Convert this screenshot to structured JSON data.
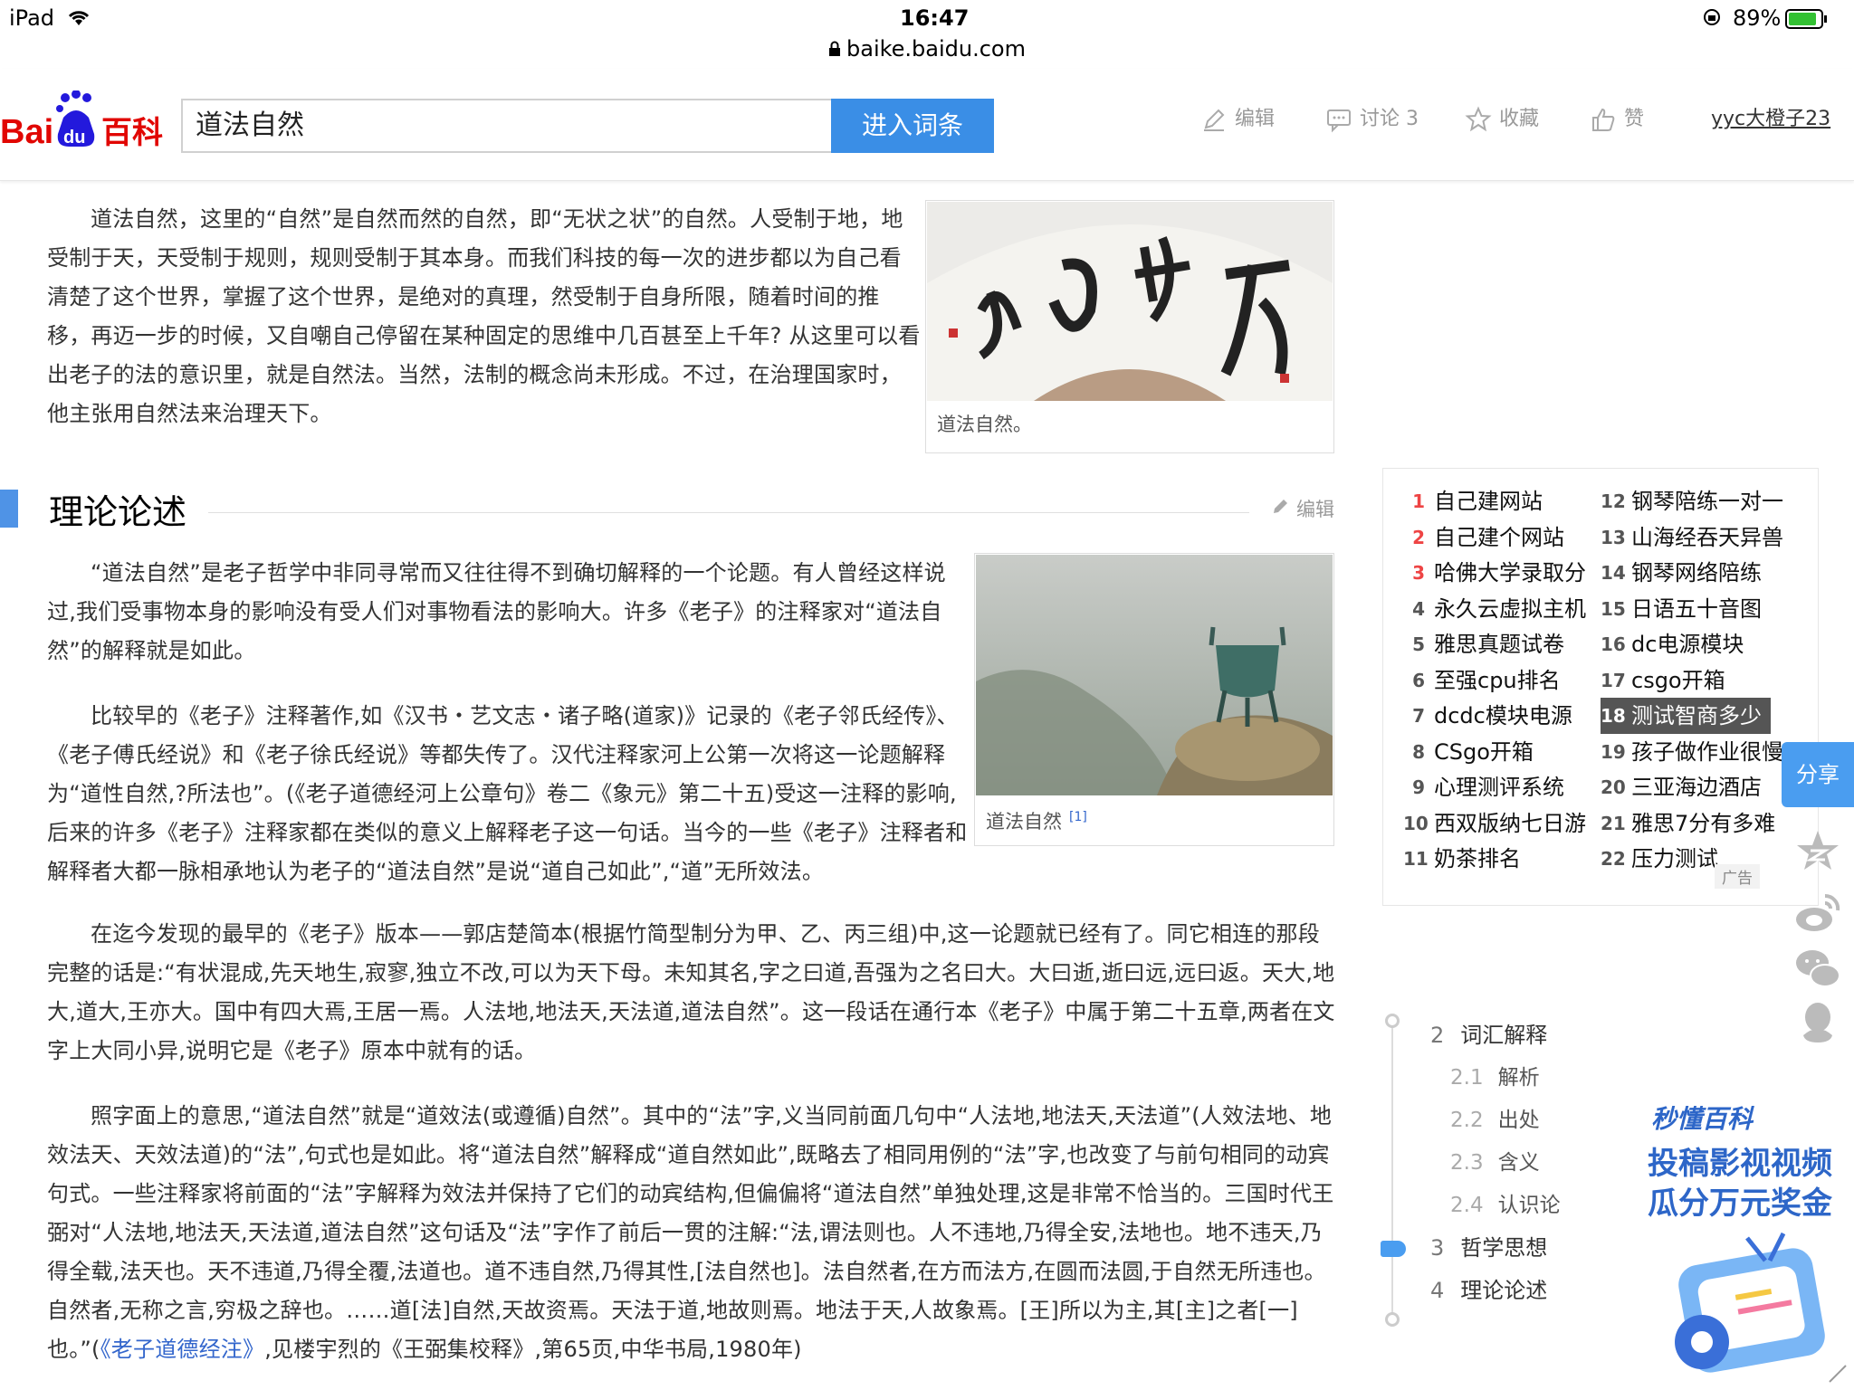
{
  "statusbar": {
    "device": "iPad",
    "time": "16:47",
    "battery": "89%",
    "url": "baike.baidu.com"
  },
  "header": {
    "logo_text_1": "Bai",
    "logo_text_2": "du",
    "logo_text_3": "百科",
    "search_value": "道法自然",
    "search_button": "进入词条",
    "actions": {
      "edit": "编辑",
      "discuss": "讨论 3",
      "collect": "收藏",
      "like": "赞"
    },
    "user": "yyc大橙子23"
  },
  "article": {
    "intro": "道法自然，这里的“自然”是自然而然的自然，即“无状之状”的自然。人受制于地，地受制于天，天受制于规则，规则受制于其本身。而我们科技的每一次的进步都以为自己看清楚了这个世界，掌握了这个世界，是绝对的真理，然受制于自身所限，随着时间的推移，再迈一步的时候，又自嘲自己停留在某种固定的思维中几百甚至上千年? 从这里可以看出老子的法的意识里，就是自然法。当然，法制的概念尚未形成。不过，在治理国家时，他主张用自然法来治理天下。",
    "figure1_caption": "道法自然。",
    "section_title": "理论论述",
    "section_edit": "编辑",
    "p2": "“道法自然”是老子哲学中非同寻常而又往往得不到确切解释的一个论题。有人曾经这样说过,我们受事物本身的影响没有受人们对事物看法的影响大。许多《老子》的注释家对“道法自然”的解释就是如此。",
    "p3": "比较早的《老子》注释著作,如《汉书・艺文志・诸子略(道家)》记录的《老子邻氏经传》、《老子傅氏经说》和《老子徐氏经说》等都失传了。汉代注释家河上公第一次将这一论题解释为“道性自然,?所法也”。(《老子道德经河上公章句》卷二《象元》第二十五)受这一注释的影响,后来的许多《老子》注释家都在类似的意义上解释老子这一句话。当今的一些《老子》注释者和解释者大都一脉相承地认为老子的“道法自然”是说“道自己如此”,“道”无所效法。",
    "figure2_caption": "道法自然",
    "figure2_ref": "[1]",
    "p4": "在迄今发现的最早的《老子》版本——郭店楚简本(根据竹简型制分为甲、乙、丙三组)中,这一论题就已经有了。同它相连的那段完整的话是:“有状混成,先天地生,寂寥,独立不改,可以为天下母。未知其名,字之曰道,吾强为之名曰大。大曰逝,逝曰远,远曰返。天大,地大,道大,王亦大。国中有四大焉,王居一焉。人法地,地法天,天法道,道法自然”。这一段话在通行本《老子》中属于第二十五章,两者在文字上大同小异,说明它是《老子》原本中就有的话。",
    "p5_a": "照字面上的意思,“道法自然”就是“道效法(或遵循)自然”。其中的“法”字,义当同前面几句中“人法地,地法天,天法道”(人效法地、地效法天、天效法道)的“法”,句式也是如此。将“道法自然”解释成“道自然如此”,既略去了相同用例的“法”字,也改变了与前句相同的动宾句式。一些注释家将前面的“法”字解释为效法并保持了它们的动宾结构,但偏偏将“道法自然”单独处理,这是非常不恰当的。三国时代王弼对“人法地,地法天,天法道,道法自然”这句话及“法”字作了前后一贯的注解:“法,谓法则也。人不违地,乃得全安,法地也。地不违天,乃得全载,法天也。天不违道,乃得全覆,法道也。道不违自然,乃得其性,[法自然也]。法自然者,在方而法方,在圆而法圆,于自然无所违也。自然者,无称之言,穷极之辞也。……道[法]自然,天故资焉。天法于道,地故则焉。地法于天,人故象焉。[王]所以为主,其[主]之者[一]也。”(",
    "p5_link": "《老子道德经注》",
    "p5_b": ",见楼宇烈的《王弼集校释》,第65页,中华书局,1980年)"
  },
  "ads": {
    "items": [
      {
        "n": "1",
        "t": "自己建网站"
      },
      {
        "n": "2",
        "t": "自己建个网站"
      },
      {
        "n": "3",
        "t": "哈佛大学录取分"
      },
      {
        "n": "4",
        "t": "永久云虚拟主机"
      },
      {
        "n": "5",
        "t": "雅思真题试卷"
      },
      {
        "n": "6",
        "t": "至强cpu排名"
      },
      {
        "n": "7",
        "t": "dcdc模块电源"
      },
      {
        "n": "8",
        "t": "CSgo开箱"
      },
      {
        "n": "9",
        "t": "心理测评系统"
      },
      {
        "n": "10",
        "t": "西双版纳七日游"
      },
      {
        "n": "11",
        "t": "奶茶排名"
      },
      {
        "n": "12",
        "t": "钢琴陪练一对一"
      },
      {
        "n": "13",
        "t": "山海经吞天异兽"
      },
      {
        "n": "14",
        "t": "钢琴网络陪练"
      },
      {
        "n": "15",
        "t": "日语五十音图"
      },
      {
        "n": "16",
        "t": "dc电源模块"
      },
      {
        "n": "17",
        "t": "csgo开箱"
      },
      {
        "n": "18",
        "t": "测试智商多少"
      },
      {
        "n": "19",
        "t": "孩子做作业很慢"
      },
      {
        "n": "20",
        "t": "三亚海边酒店"
      },
      {
        "n": "21",
        "t": "雅思7分有多难"
      },
      {
        "n": "22",
        "t": "压力测试"
      }
    ],
    "ad_label": "广告"
  },
  "share": {
    "label": "分享"
  },
  "toc": {
    "items": [
      {
        "n": "2",
        "t": "词汇解释",
        "level": 1
      },
      {
        "n": "2.1",
        "t": "解析",
        "level": 2
      },
      {
        "n": "2.2",
        "t": "出处",
        "level": 2
      },
      {
        "n": "2.3",
        "t": "含义",
        "level": 2
      },
      {
        "n": "2.4",
        "t": "认识论",
        "level": 2
      },
      {
        "n": "3",
        "t": "哲学思想",
        "level": 1
      },
      {
        "n": "4",
        "t": "理论论述",
        "level": 1
      }
    ]
  },
  "promo": {
    "brand": "秒懂百科",
    "line1": "投稿影视视频",
    "line2": "瓜分万元奖金"
  },
  "colors": {
    "accent": "#3a8ee6",
    "link": "#3366cc",
    "highlight": "#555555"
  }
}
